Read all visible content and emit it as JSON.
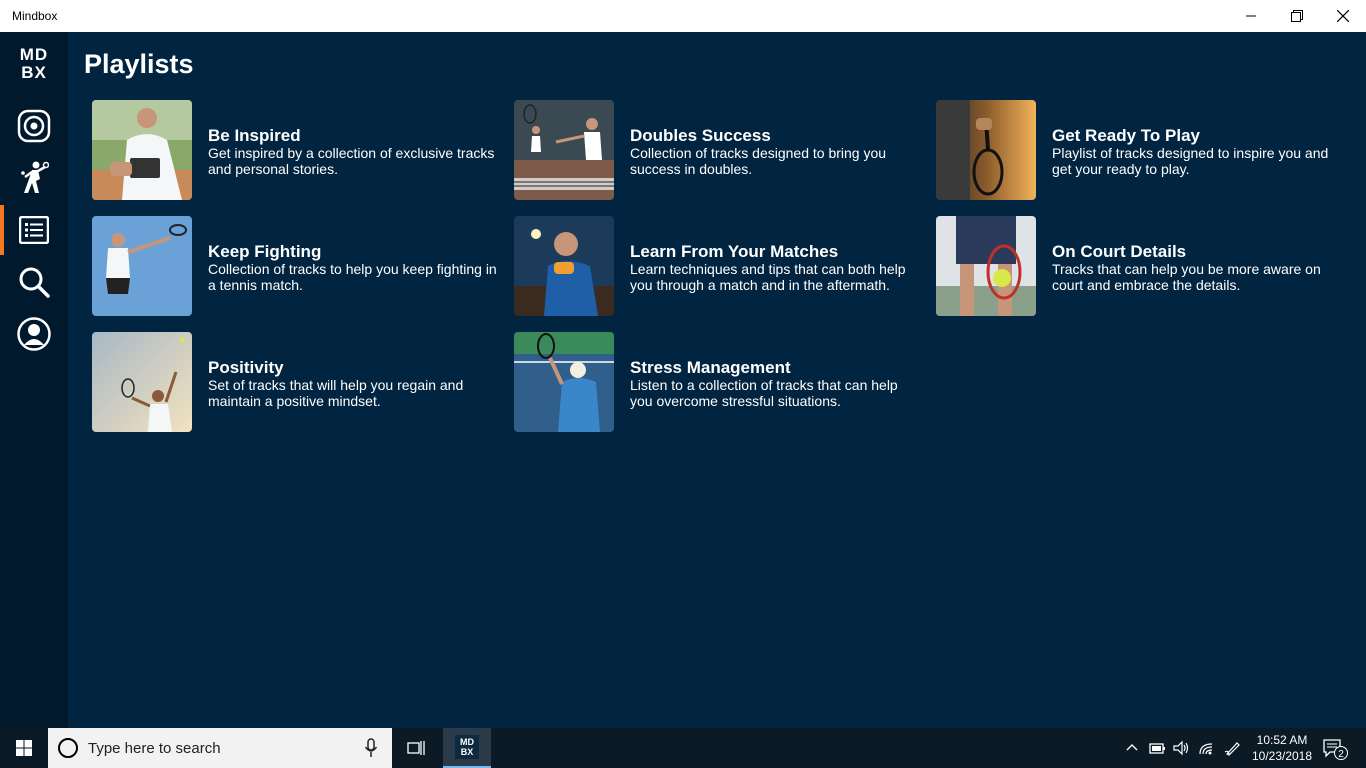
{
  "window": {
    "title": "Mindbox"
  },
  "sidebar": {
    "logo_top": "MD",
    "logo_bottom": "BX",
    "items": [
      {
        "name": "speaker-icon",
        "active": false
      },
      {
        "name": "tennis-player-icon",
        "active": false
      },
      {
        "name": "list-icon",
        "active": true
      },
      {
        "name": "search-icon",
        "active": false
      },
      {
        "name": "profile-icon",
        "active": false
      }
    ]
  },
  "main": {
    "title": "Playlists",
    "playlists": [
      {
        "title": "Be Inspired",
        "description": "Get inspired by a collection of exclusive tracks and personal stories."
      },
      {
        "title": "Doubles Success",
        "description": "Collection of tracks designed to bring you success in doubles."
      },
      {
        "title": "Get Ready To Play",
        "description": "Playlist of tracks designed to inspire you and get your ready to play."
      },
      {
        "title": "Keep Fighting",
        "description": "Collection of tracks to help you keep fighting in a tennis match."
      },
      {
        "title": "Learn From Your Matches",
        "description": "Learn techniques and tips that can both help you through a match and in the aftermath."
      },
      {
        "title": "On Court Details",
        "description": "Tracks that can help you be more aware on court and embrace the details."
      },
      {
        "title": "Positivity",
        "description": "Set of tracks that will help you regain and maintain a positive mindset."
      },
      {
        "title": "Stress Management",
        "description": "Listen to a collection of tracks that can help you overcome stressful situations."
      }
    ]
  },
  "taskbar": {
    "search_placeholder": "Type here to search",
    "app_logo_top": "MD",
    "app_logo_bottom": "BX",
    "time": "10:52 AM",
    "date": "10/23/2018",
    "notification_count": "2"
  },
  "colors": {
    "background": "#012440",
    "sidebar": "#00192d",
    "accent": "#f47721",
    "taskbar": "#0b1a25"
  }
}
